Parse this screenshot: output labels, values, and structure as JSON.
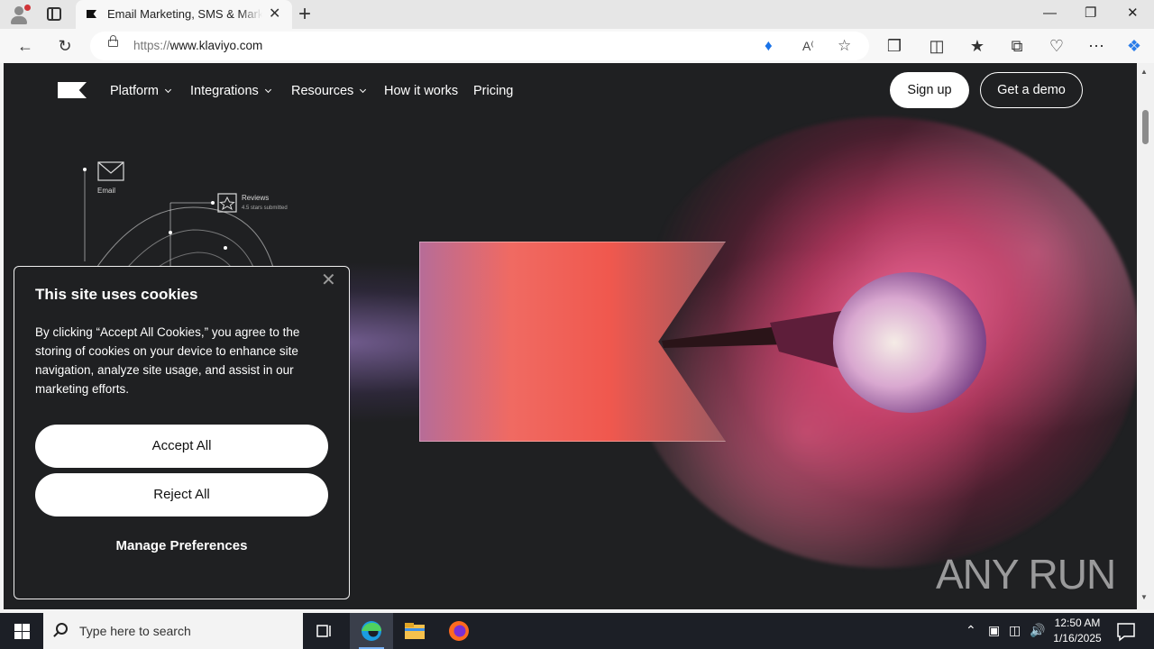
{
  "browser": {
    "tab_title": "Email Marketing, SMS & Marketing",
    "tab_close": "✕",
    "new_tab": "+",
    "url_prefix": "https://",
    "url_main": "www.klaviyo.com",
    "window_controls": {
      "minimize": "—",
      "restore": "❐",
      "close": "✕"
    }
  },
  "nav": {
    "items": [
      {
        "label": "Platform",
        "dropdown": true
      },
      {
        "label": "Integrations",
        "dropdown": true
      },
      {
        "label": "Resources",
        "dropdown": true
      },
      {
        "label": "How it works",
        "dropdown": false
      },
      {
        "label": "Pricing",
        "dropdown": false
      }
    ],
    "signup": "Sign up",
    "demo": "Get a demo"
  },
  "hero": {
    "diagram": {
      "email_label": "Email",
      "reviews_label": "Reviews",
      "reviews_sub": "4.5 stars submitted"
    }
  },
  "cookie": {
    "title": "This site uses cookies",
    "body": "By clicking “Accept All Cookies,” you agree to the storing of cookies on your device to enhance site navigation, analyze site usage, and assist in our marketing efforts.",
    "accept": "Accept All",
    "reject": "Reject All",
    "manage": "Manage Preferences",
    "close": "✕"
  },
  "watermark": "ANY RUN",
  "taskbar": {
    "search_placeholder": "Type here to search",
    "time": "12:50 AM",
    "date": "1/16/2025"
  },
  "colors": {
    "page_bg": "#1f2022",
    "accent_coral": "#f0584e",
    "powder_pink": "#e85a8a"
  }
}
